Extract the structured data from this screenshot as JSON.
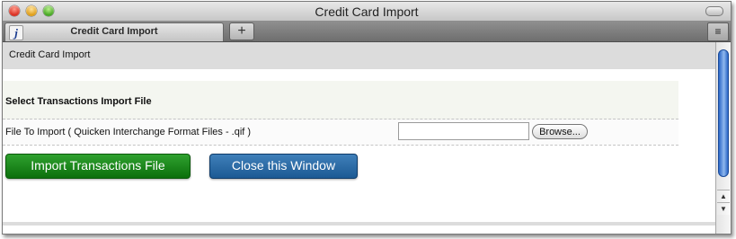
{
  "window": {
    "title": "Credit Card Import"
  },
  "tabs": {
    "active_label": "Credit Card Import",
    "favicon_glyph": "j",
    "add_label": "+",
    "menu_glyph": "≡"
  },
  "page": {
    "header": "Credit Card Import",
    "section_title": "Select Transactions Import File",
    "file_label": "File To Import ( Quicken Interchange Format Files - .qif )",
    "file_value": "",
    "browse_label": "Browse...",
    "import_button": "Import Transactions File",
    "close_button": "Close this Window"
  },
  "scrollbar": {
    "up_glyph": "▲",
    "down_glyph": "▼"
  }
}
